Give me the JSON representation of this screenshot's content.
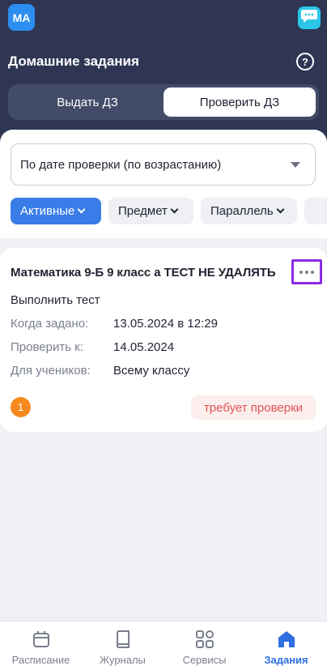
{
  "header": {
    "avatar_initials": "МА",
    "title": "Домашние задания",
    "help_symbol": "?",
    "tabs": [
      {
        "label": "Выдать ДЗ",
        "active": false
      },
      {
        "label": "Проверить ДЗ",
        "active": true
      }
    ],
    "colors": {
      "background": "#2e3654",
      "avatar": "#2b8ef0",
      "chat": "#2cc7e8"
    }
  },
  "filters": {
    "sort_value": "По дате проверки (по возрастанию)",
    "chips": [
      {
        "label": "Активные",
        "active": true
      },
      {
        "label": "Предмет",
        "active": false
      },
      {
        "label": "Параллель",
        "active": false
      }
    ],
    "accent": "#3a7de8"
  },
  "task": {
    "title": "Математика 9-Б 9 класс а ТЕСТ НЕ УДАЛЯТЬ",
    "type": "Выполнить тест",
    "rows": [
      {
        "label": "Когда задано:",
        "value": "13.05.2024 в 12:29"
      },
      {
        "label": "Проверить к:",
        "value": "14.05.2024"
      },
      {
        "label": "Для учеников:",
        "value": "Всему классу"
      }
    ],
    "count": "1",
    "status": "требует проверки"
  },
  "nav": {
    "items": [
      {
        "label": "Расписание",
        "icon": "calendar-icon",
        "active": false
      },
      {
        "label": "Журналы",
        "icon": "book-icon",
        "active": false
      },
      {
        "label": "Сервисы",
        "icon": "grid-icon",
        "active": false
      },
      {
        "label": "Задания",
        "icon": "home-icon",
        "active": true
      }
    ],
    "active_color": "#2f6fe0"
  }
}
